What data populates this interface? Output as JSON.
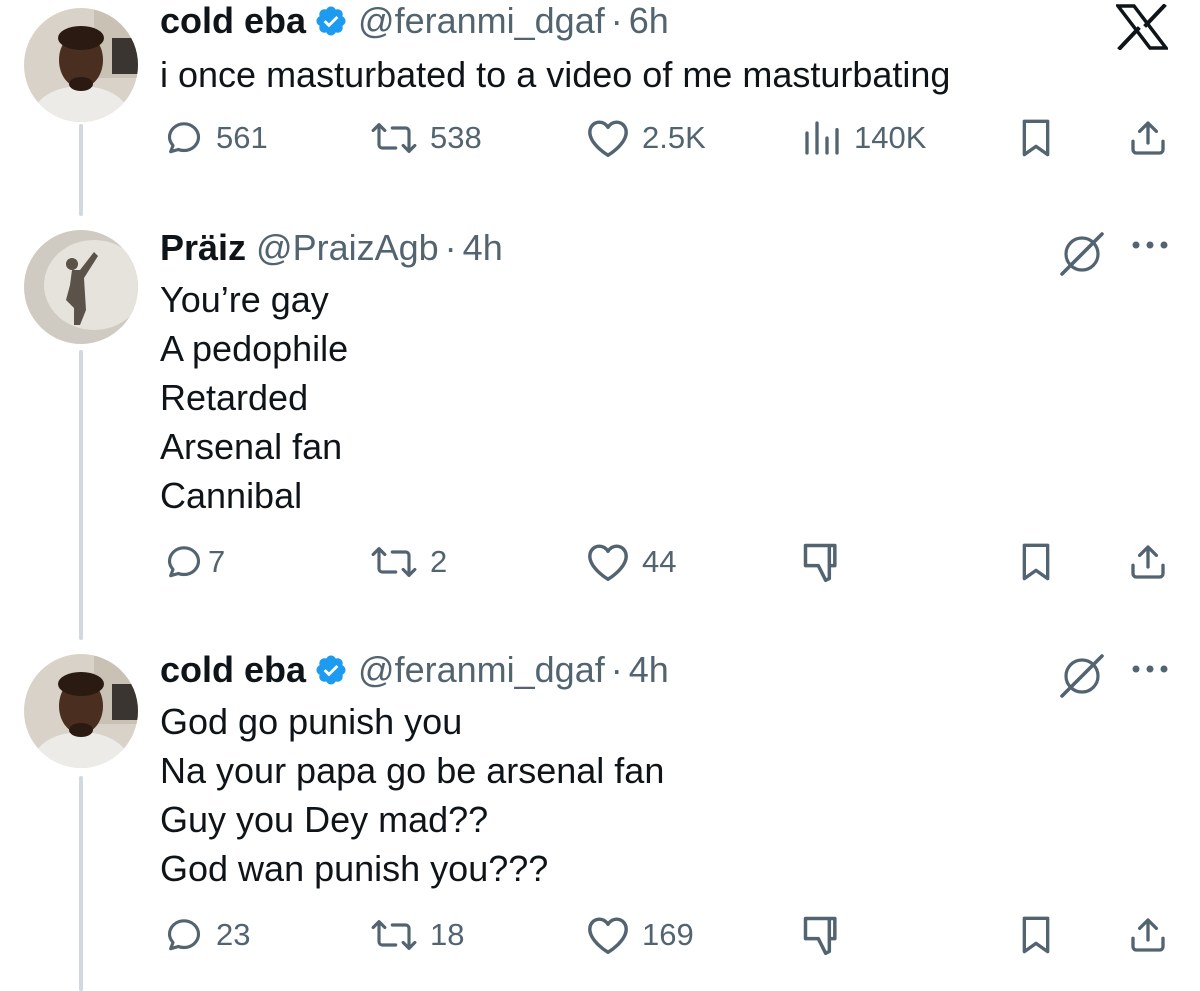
{
  "tweets": [
    {
      "name": "cold eba",
      "verified": true,
      "handle": "@feranmi_dgaf",
      "dot": "·",
      "time": "6h",
      "lines": [
        "i once masturbated to a video of me masturbating"
      ],
      "replies": "561",
      "reposts": "538",
      "likes": "2.5K",
      "views": "140K",
      "corner_icon": "x-logo-icon"
    },
    {
      "name": "Präiz",
      "verified": false,
      "handle": "@PraizAgb",
      "dot": "·",
      "time": "4h",
      "lines": [
        "You’re gay",
        "A pedophile",
        "Retarded",
        "Arsenal fan",
        "Cannibal"
      ],
      "replies": "7",
      "reposts": "2",
      "likes": "44",
      "corner_icon": "grok-icon"
    },
    {
      "name": "cold eba",
      "verified": true,
      "handle": "@feranmi_dgaf",
      "dot": "·",
      "time": "4h",
      "lines": [
        "God go punish you",
        "Na your papa go be arsenal fan",
        "Guy you Dey mad??",
        "God wan punish you???"
      ],
      "replies": "23",
      "reposts": "18",
      "likes": "169",
      "corner_icon": "grok-icon"
    }
  ],
  "colors": {
    "text": "#0f1419",
    "secondary": "#536471",
    "verified_blue": "#1d9bf0",
    "thread_line": "#cfd9de"
  }
}
